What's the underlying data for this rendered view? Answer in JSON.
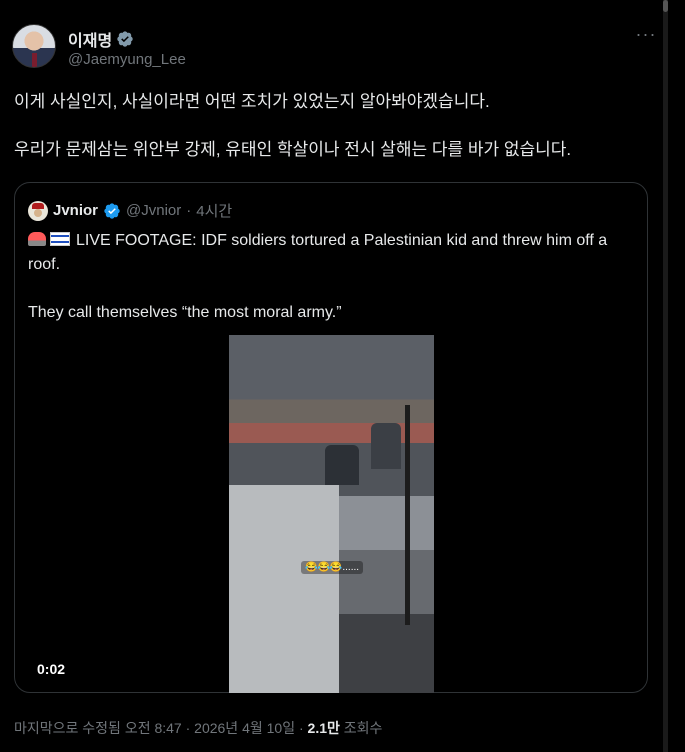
{
  "tweet": {
    "author": {
      "name": "이재명",
      "handle": "@Jaemyung_Lee",
      "verified": "gray-checkmark-icon"
    },
    "more_label": "···",
    "text": [
      "이게 사실인지, 사실이라면 어떤 조치가 있었는지 알아봐야겠습니다.",
      "우리가 문제삼는 위안부 강제, 유태인 학살이나 전시 살해는 다를 바가 없습니다."
    ],
    "quote": {
      "author_name": "Jvnior",
      "author_handle": "@Jvnior",
      "separator": "·",
      "time": "4시간",
      "verified": "blue-checkmark-icon",
      "text_line1": "LIVE FOOTAGE: IDF soldiers tortured a Palestinian kid and threw him off a roof.",
      "text_line2": "They call themselves “the most moral army.”",
      "video": {
        "duration": "0:02",
        "overlay_text": "😂😂😂......"
      }
    },
    "meta": {
      "edited_prefix": "마지막으로 수정됨 오전 8:47 · 2026년 4월 10일 · ",
      "views": "2.1만",
      "views_label": " 조회수"
    }
  },
  "colors": {
    "background": "#000000",
    "text": "#e7e9ea",
    "secondary": "#71767b",
    "border": "#2f3336",
    "verified_blue": "#1d9bf0",
    "verified_gray": "#829aab"
  }
}
